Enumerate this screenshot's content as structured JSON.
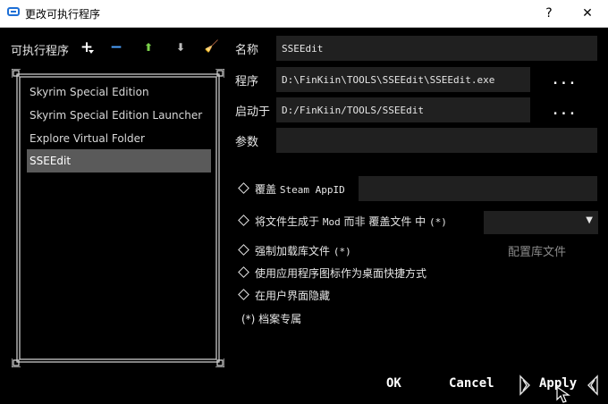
{
  "window": {
    "title": "更改可执行程序",
    "help_glyph": "?",
    "close_glyph": "✕"
  },
  "toolbar": {
    "label": "可执行程序",
    "add_glyph": "+",
    "remove_glyph": "−",
    "up_glyph": "⬆",
    "down_glyph": "⬇",
    "clean_glyph": "🧹"
  },
  "executables": [
    {
      "label": "Skyrim Special Edition"
    },
    {
      "label": "Skyrim Special Edition Launcher"
    },
    {
      "label": "Explore Virtual Folder"
    },
    {
      "label": "SSEEdit"
    }
  ],
  "form": {
    "name_label": "名称",
    "name_value": "SSEEdit",
    "program_label": "程序",
    "program_value": "D:\\FinKiin\\TOOLS\\SSEEdit\\SSEEdit.exe",
    "start_label": "启动于",
    "start_value": "D:/FinKiin/TOOLS/SSEEdit",
    "args_label": "参数",
    "args_value": "",
    "browse_label": "...",
    "browse_label2": "..."
  },
  "options": {
    "override_appid_prefix": "覆盖",
    "override_appid_mono": "Steam AppID",
    "override_appid_value": "",
    "gen_files_a": "将文件生成于",
    "gen_files_mono": "Mod",
    "gen_files_b": "而非 覆盖文件 中",
    "gen_files_star": "(*)",
    "force_load_label": "强制加载库文件",
    "force_load_star": "(*)",
    "configure_libs": "配置库文件",
    "use_icon": "使用应用程序图标作为桌面快捷方式",
    "hide_ui": "在用户界面隐藏",
    "profile_note": "(*) 档案专属"
  },
  "buttons": {
    "ok": "OK",
    "cancel": "Cancel",
    "apply": "Apply"
  },
  "colors": {
    "background": "#000000",
    "field_bg": "#202020",
    "selected_row": "#5a5a5a",
    "up_green": "#7ad04a"
  }
}
